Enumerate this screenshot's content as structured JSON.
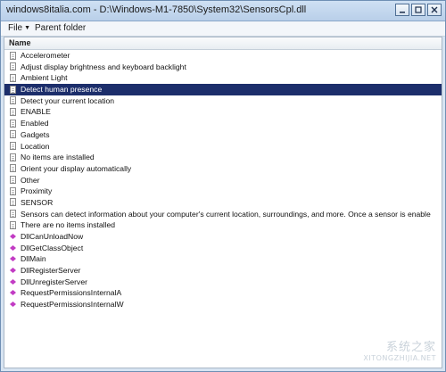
{
  "window": {
    "title": "windows8italia.com - D:\\Windows-M1-7850\\System32\\SensorsCpl.dll"
  },
  "menu": {
    "file_label": "File",
    "parent_label": "Parent folder"
  },
  "list": {
    "column_header": "Name",
    "rows": [
      {
        "label": "Accelerometer",
        "icon": "document-icon"
      },
      {
        "label": "Adjust display brightness and keyboard backlight",
        "icon": "document-icon"
      },
      {
        "label": "Ambient Light",
        "icon": "document-icon"
      },
      {
        "label": "Detect human presence",
        "icon": "document-icon",
        "selected": true
      },
      {
        "label": "Detect your current location",
        "icon": "document-icon"
      },
      {
        "label": "ENABLE",
        "icon": "document-icon"
      },
      {
        "label": "Enabled",
        "icon": "document-icon"
      },
      {
        "label": "Gadgets",
        "icon": "document-icon"
      },
      {
        "label": "Location",
        "icon": "document-icon"
      },
      {
        "label": "No items are installed",
        "icon": "document-icon"
      },
      {
        "label": "Orient your display automatically",
        "icon": "document-icon"
      },
      {
        "label": "Other",
        "icon": "document-icon"
      },
      {
        "label": "Proximity",
        "icon": "document-icon"
      },
      {
        "label": "SENSOR",
        "icon": "document-icon"
      },
      {
        "label": "Sensors can detect information about your computer's current location, surroundings, and more. Once a sensor is enable",
        "icon": "document-icon"
      },
      {
        "label": "There are no items installed",
        "icon": "document-icon"
      },
      {
        "label": "DllCanUnloadNow",
        "icon": "function-icon"
      },
      {
        "label": "DllGetClassObject",
        "icon": "function-icon"
      },
      {
        "label": "DllMain",
        "icon": "function-icon"
      },
      {
        "label": "DllRegisterServer",
        "icon": "function-icon"
      },
      {
        "label": "DllUnregisterServer",
        "icon": "function-icon"
      },
      {
        "label": "RequestPermissionsInternalA",
        "icon": "function-icon"
      },
      {
        "label": "RequestPermissionsInternalW",
        "icon": "function-icon"
      }
    ]
  },
  "watermark": {
    "main": "系统之家",
    "sub": "XITONGZHIJIA.NET"
  },
  "colors": {
    "selection": "#1c2e6b",
    "function_icon": "#c23cc4"
  }
}
